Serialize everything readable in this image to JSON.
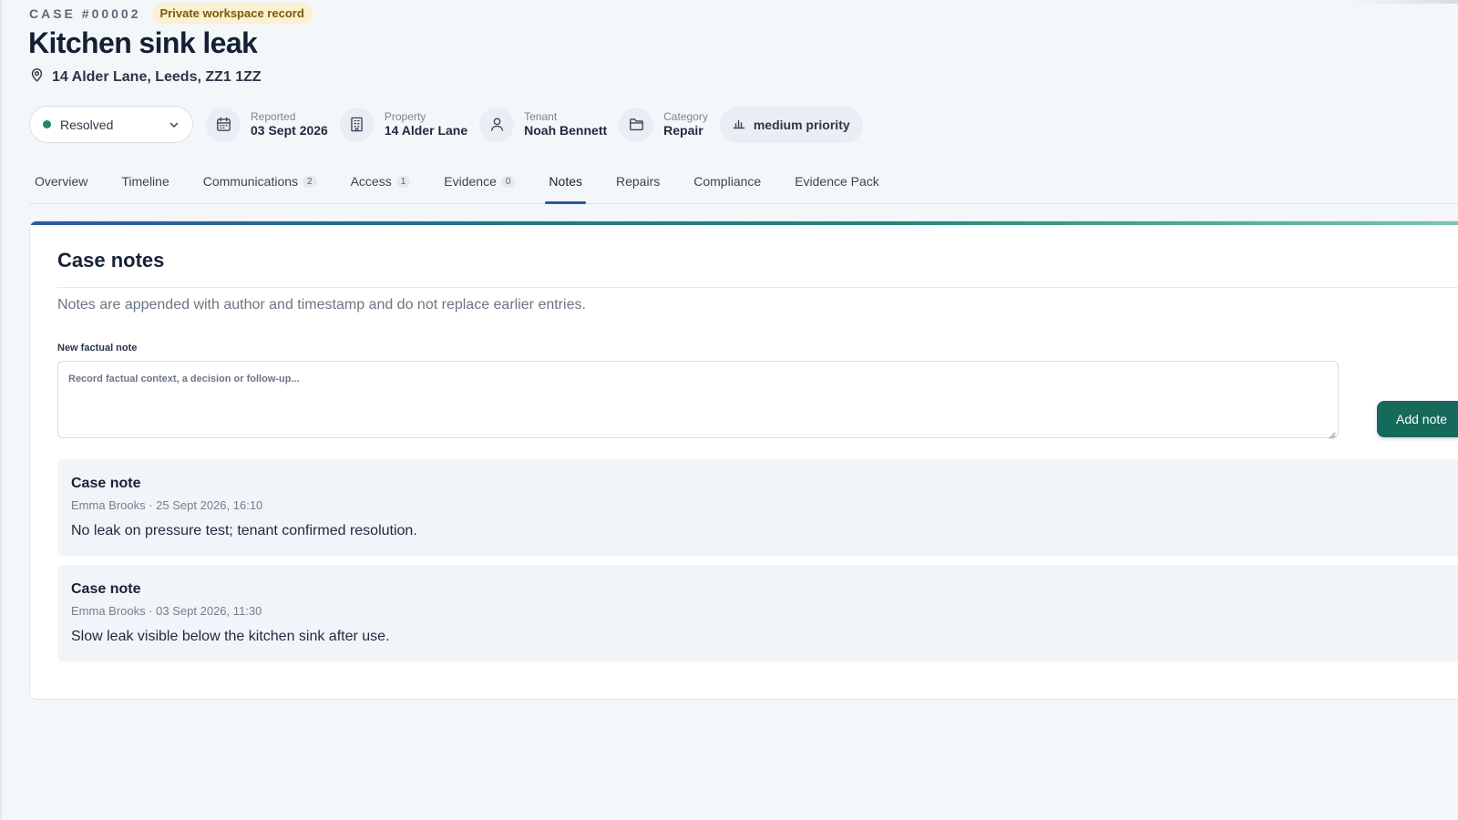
{
  "case": {
    "code": "CASE #00002",
    "badge": "Private workspace record",
    "title": "Kitchen sink leak",
    "address": "14 Alder Lane, Leeds, ZZ1 1ZZ"
  },
  "status": {
    "value": "Resolved",
    "color": "#1f8a5b"
  },
  "meta": {
    "reported": {
      "label": "Reported",
      "value": "03 Sept 2026",
      "icon": "calendar-icon"
    },
    "property": {
      "label": "Property",
      "value": "14 Alder Lane",
      "icon": "building-icon"
    },
    "tenant": {
      "label": "Tenant",
      "value": "Noah Bennett",
      "icon": "user-icon"
    },
    "category": {
      "label": "Category",
      "value": "Repair",
      "icon": "folder-icon"
    },
    "priority": {
      "value": "medium priority",
      "icon": "bar-chart-icon"
    }
  },
  "tabs": [
    {
      "label": "Overview"
    },
    {
      "label": "Timeline"
    },
    {
      "label": "Communications",
      "count": "2"
    },
    {
      "label": "Access",
      "count": "1"
    },
    {
      "label": "Evidence",
      "count": "0"
    },
    {
      "label": "Notes",
      "active": true
    },
    {
      "label": "Repairs"
    },
    {
      "label": "Compliance"
    },
    {
      "label": "Evidence Pack"
    }
  ],
  "notes_panel": {
    "title": "Case notes",
    "description": "Notes are appended with author and timestamp and do not replace earlier entries.",
    "field_label": "New factual note",
    "placeholder": "Record factual context, a decision or follow-up...",
    "add_button": "Add note",
    "accent_color": "#166a5b"
  },
  "notes": [
    {
      "title": "Case note",
      "meta": "Emma Brooks · 25 Sept 2026, 16:10",
      "body": "No leak on pressure test; tenant confirmed resolution."
    },
    {
      "title": "Case note",
      "meta": "Emma Brooks · 03 Sept 2026, 11:30",
      "body": "Slow leak visible below the kitchen sink after use."
    }
  ]
}
